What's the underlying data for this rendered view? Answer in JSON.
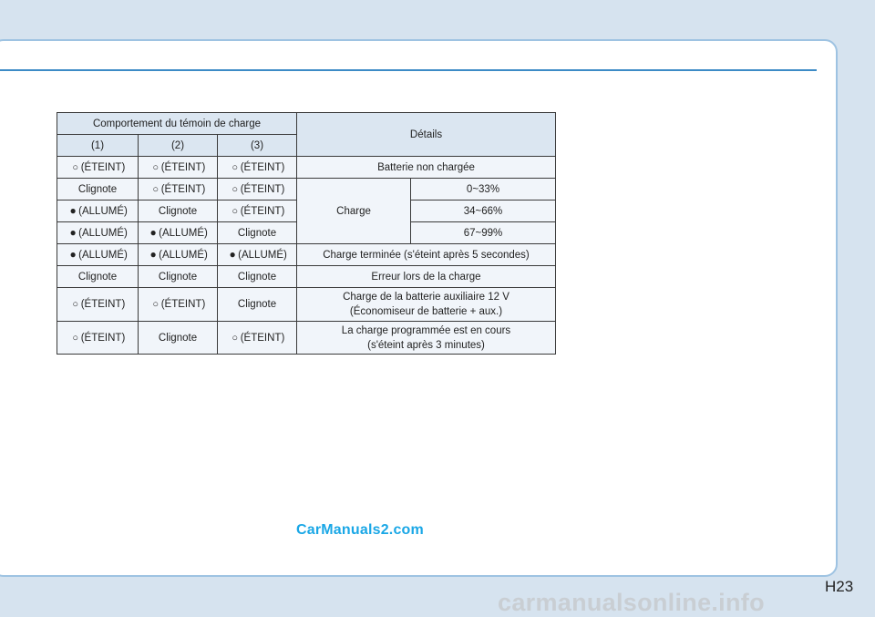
{
  "table": {
    "header": {
      "behavior": "Comportement du témoin de charge",
      "details": "Détails",
      "col1": "(1)",
      "col2": "(2)",
      "col3": "(3)"
    },
    "rows": [
      {
        "c1": "(ÉTEINT)",
        "c1_icon": "off-circle",
        "c2": "(ÉTEINT)",
        "c2_icon": "off-circle",
        "c3": "(ÉTEINT)",
        "c3_icon": "off-circle",
        "detail": "Batterie non chargée"
      },
      {
        "c1": "Clignote",
        "c2": "(ÉTEINT)",
        "c2_icon": "off-circle",
        "c3": "(ÉTEINT)",
        "c3_icon": "off-circle",
        "detail": "Charge",
        "level": "0~33%"
      },
      {
        "c1": "(ALLUMÉ)",
        "c1_icon": "on-circle",
        "c2": "Clignote",
        "c3": "(ÉTEINT)",
        "c3_icon": "off-circle",
        "level": "34~66%"
      },
      {
        "c1": "(ALLUMÉ)",
        "c1_icon": "on-circle",
        "c2": "(ALLUMÉ)",
        "c2_icon": "on-circle",
        "c3": "Clignote",
        "level": "67~99%"
      },
      {
        "c1": "(ALLUMÉ)",
        "c1_icon": "on-circle",
        "c2": "(ALLUMÉ)",
        "c2_icon": "on-circle",
        "c3": "(ALLUMÉ)",
        "c3_icon": "on-circle",
        "detail": "Charge terminée (s'éteint après 5 secondes)"
      },
      {
        "c1": "Clignote",
        "c2": "Clignote",
        "c3": "Clignote",
        "detail": "Erreur lors de la charge"
      },
      {
        "c1": "(ÉTEINT)",
        "c1_icon": "off-circle",
        "c2": "(ÉTEINT)",
        "c2_icon": "off-circle",
        "c3": "Clignote",
        "detail_line1": "Charge de la batterie auxiliaire 12 V",
        "detail_line2": "(Économiseur de batterie + aux.)"
      },
      {
        "c1": "(ÉTEINT)",
        "c1_icon": "off-circle",
        "c2": "Clignote",
        "c3": "(ÉTEINT)",
        "c3_icon": "off-circle",
        "detail_line1": "La charge programmée est en cours",
        "detail_line2": "(s'éteint après 3 minutes)"
      }
    ]
  },
  "symbols": {
    "off": "○",
    "on": "●"
  },
  "watermark": "CarManuals2.com",
  "page_number": "H23",
  "footer_watermark": "carmanualsonline.info",
  "colors": {
    "background": "#d6e3ef",
    "accent_rule": "#3d8bc6",
    "header_cell": "#dbe6f1",
    "body_cell": "#f1f5fa",
    "watermark": "#1aa7e6"
  }
}
